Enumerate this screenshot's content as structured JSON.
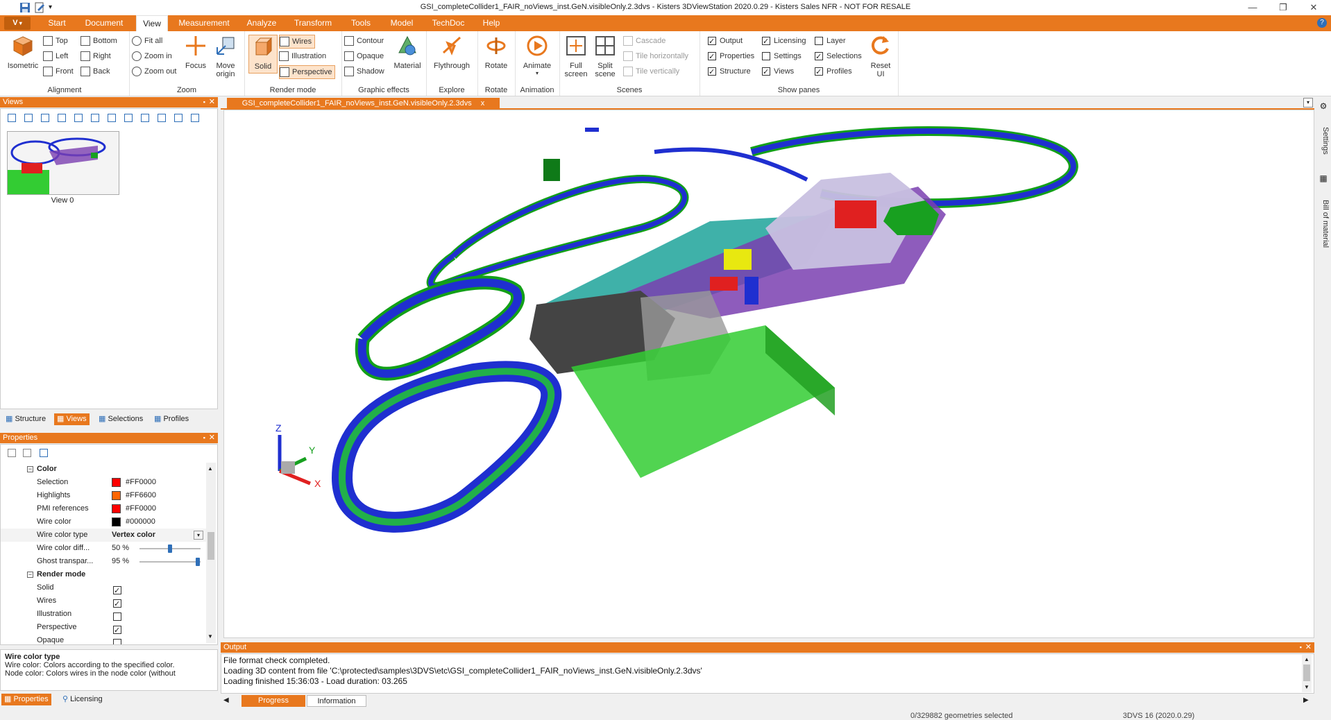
{
  "window": {
    "title": "GSI_completeCollider1_FAIR_noViews_inst.GeN.visibleOnly.2.3dvs - Kisters 3DViewStation 2020.0.29 - Kisters Sales NFR - NOT FOR RESALE",
    "minimize": "—",
    "maximize": "❐",
    "close": "✕"
  },
  "menu": {
    "app": "V",
    "items": [
      "Start",
      "Document",
      "View",
      "Measurement",
      "Analyze",
      "Transform",
      "Tools",
      "Model",
      "TechDoc",
      "Help"
    ],
    "active": "View",
    "help_icon": "?"
  },
  "ribbon": {
    "alignment": {
      "label": "Alignment",
      "isometric": "Isometric",
      "top": "Top",
      "left": "Left",
      "front": "Front",
      "bottom": "Bottom",
      "right": "Right",
      "back": "Back"
    },
    "zoom": {
      "label": "Zoom",
      "fit_all": "Fit all",
      "zoom_in": "Zoom in",
      "zoom_out": "Zoom out",
      "focus": "Focus",
      "move_origin_1": "Move",
      "move_origin_2": "origin"
    },
    "render_mode": {
      "label": "Render mode",
      "solid": "Solid",
      "wires": "Wires",
      "illustration": "Illustration",
      "perspective": "Perspective"
    },
    "graphic_effects": {
      "label": "Graphic effects",
      "contour": "Contour",
      "opaque": "Opaque",
      "shadow": "Shadow",
      "material": "Material"
    },
    "explore": {
      "label": "Explore",
      "flythrough": "Flythrough"
    },
    "rotate": {
      "label": "Rotate",
      "rotate": "Rotate"
    },
    "animation": {
      "label": "Animation",
      "animate": "Animate"
    },
    "scenes": {
      "label": "Scenes",
      "full_1": "Full",
      "full_2": "screen",
      "split_1": "Split",
      "split_2": "scene",
      "cascade": "Cascade",
      "tile_h": "Tile horizontally",
      "tile_v": "Tile vertically"
    },
    "show_panes": {
      "label": "Show panes",
      "output": "Output",
      "properties": "Properties",
      "structure": "Structure",
      "licensing": "Licensing",
      "settings": "Settings",
      "views": "Views",
      "layer": "Layer",
      "selections": "Selections",
      "profiles": "Profiles",
      "reset_1": "Reset",
      "reset_2": "UI"
    }
  },
  "views_panel": {
    "title": "Views",
    "view_label": "View 0",
    "tabs": [
      "Structure",
      "Views",
      "Selections",
      "Profiles"
    ],
    "active_tab": "Views"
  },
  "properties_panel": {
    "title": "Properties",
    "color_section": "Color",
    "rows": [
      {
        "name": "Selection",
        "value": "#FF0000",
        "swatch": "#FF0000"
      },
      {
        "name": "Highlights",
        "value": "#FF6600",
        "swatch": "#FF6600"
      },
      {
        "name": "PMI references",
        "value": "#FF0000",
        "swatch": "#FF0000"
      },
      {
        "name": "Wire color",
        "value": "#000000",
        "swatch": "#000000"
      }
    ],
    "wire_color_type": {
      "name": "Wire color type",
      "value": "Vertex color"
    },
    "wire_color_diff": {
      "name": "Wire color diff...",
      "value": "50 %",
      "level": 0.5
    },
    "ghost_transp": {
      "name": "Ghost transpar...",
      "value": "95 %",
      "level": 0.95
    },
    "render_section": "Render mode",
    "render_rows": [
      {
        "name": "Solid",
        "checked": true
      },
      {
        "name": "Wires",
        "checked": true
      },
      {
        "name": "Illustration",
        "checked": false
      },
      {
        "name": "Perspective",
        "checked": true
      },
      {
        "name": "Opaque",
        "checked": false
      }
    ],
    "help_title": "Wire color type",
    "help_line1": "Wire color: Colors according to the specified color.",
    "help_line2": "Node color: Colors wires in the node color (without",
    "tabs": [
      "Properties",
      "Licensing"
    ],
    "active_tab": "Properties"
  },
  "document_tab": {
    "label": "GSI_completeCollider1_FAIR_noViews_inst.GeN.visibleOnly.2.3dvs",
    "close": "x"
  },
  "right_tabs": [
    "Settings",
    "Bill of material"
  ],
  "axes": {
    "x": "X",
    "y": "Y",
    "z": "Z"
  },
  "output": {
    "title": "Output",
    "lines": [
      "File format check completed.",
      "Loading 3D content from file 'C:\\protected\\samples\\3DVS\\etc\\GSI_completeCollider1_FAIR_noViews_inst.GeN.visibleOnly.2.3dvs'",
      "Loading finished 15:36:03 - Load duration: 03.265"
    ],
    "tabs": [
      "Progress",
      "Information"
    ],
    "active_tab": "Progress"
  },
  "status": {
    "selected": "0/329882 geometries selected",
    "version": "3DVS 16 (2020.0.29)"
  },
  "colors": {
    "accent": "#e8781e",
    "ring_blue": "#1f2fd0",
    "ring_green": "#18a020",
    "box_green": "#33cc33",
    "teal": "#2aa8a0",
    "purple": "#7a3fb0",
    "gray": "#555555"
  }
}
